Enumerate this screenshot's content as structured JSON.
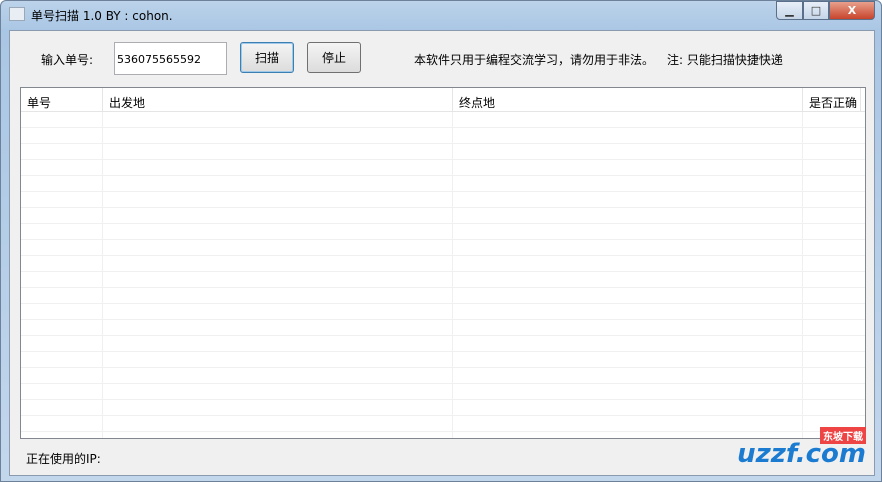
{
  "window": {
    "title": "单号扫描 1.0 BY : cohon.",
    "minimize": "▁",
    "maximize": "□",
    "close": "X"
  },
  "form": {
    "input_label": "输入单号:",
    "input_value": "536075565592",
    "scan_button": "扫描",
    "stop_button": "停止",
    "notice": "本软件只用于编程交流学习，请勿用于非法。",
    "note": "注: 只能扫描快捷快递"
  },
  "table": {
    "columns": [
      "单号",
      "出发地",
      "终点地",
      "是否正确"
    ],
    "rows": []
  },
  "status": {
    "ip_label": "正在使用的IP:"
  },
  "watermark": {
    "text": "uzzf.com",
    "badge": "东坡下载"
  }
}
